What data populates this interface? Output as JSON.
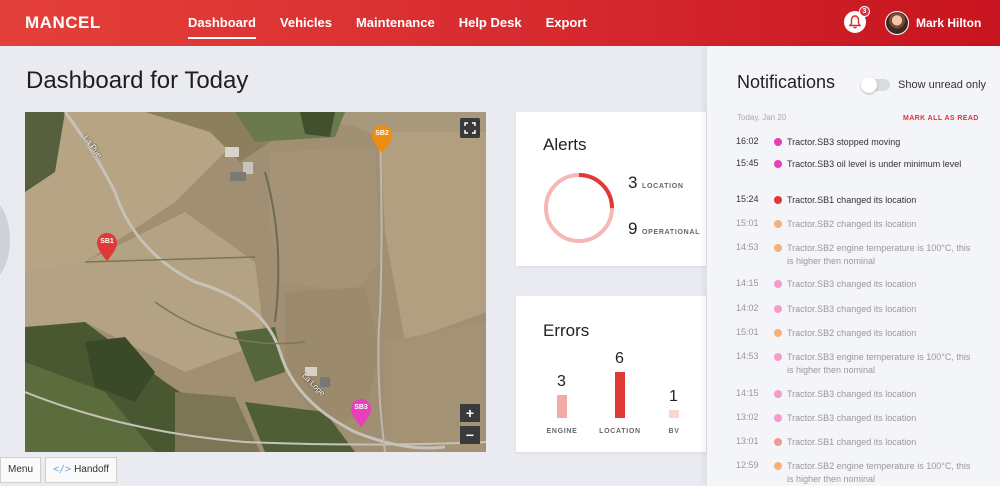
{
  "brand": "MANCEL",
  "nav": {
    "items": [
      {
        "label": "Dashboard",
        "active": true
      },
      {
        "label": "Vehicles",
        "active": false
      },
      {
        "label": "Maintenance",
        "active": false
      },
      {
        "label": "Help Desk",
        "active": false
      },
      {
        "label": "Export",
        "active": false
      }
    ]
  },
  "header": {
    "notification_count": "3",
    "user_name": "Mark Hilton",
    "accent_color": "#d62a2f"
  },
  "page": {
    "title": "Dashboard for Today"
  },
  "map": {
    "markers": [
      {
        "label": "SB2",
        "color": "#f08c10"
      },
      {
        "label": "SB1",
        "color": "#dd3a35"
      },
      {
        "label": "SB3",
        "color": "#e83fba"
      }
    ],
    "road_labels": [
      "La Pue",
      "La Loge"
    ],
    "zoom_in": "+",
    "zoom_out": "−",
    "fullscreen_icon": "fullscreen-icon"
  },
  "alerts": {
    "title": "Alerts",
    "location_count": "3",
    "location_label": "LOCATION",
    "operational_count": "9",
    "operational_label": "OPERATIONAL",
    "location_fraction": 0.25
  },
  "errors": {
    "title": "Errors",
    "bars": [
      {
        "label": "ENGINE",
        "value": "3",
        "color": "#f4aaa6"
      },
      {
        "label": "LOCATION",
        "value": "6",
        "color": "#e03a37"
      },
      {
        "label": "BV",
        "value": "1",
        "color": "#f9d5d3"
      }
    ]
  },
  "notifications": {
    "title": "Notifications",
    "toggle_label": "Show unread only",
    "date": "Today, Jan 20",
    "mark_all": "MARK ALL AS READ",
    "items": [
      {
        "time": "16:02",
        "text": "Tractor.SB3 stopped moving",
        "color": "#e83fba",
        "read": false
      },
      {
        "time": "15:45",
        "text": "Tractor.SB3 oil level is under minimum level",
        "color": "#e83fba",
        "read": false
      },
      {
        "time": "15:24",
        "text": "Tractor.SB1 changed its location",
        "color": "#dd3a35",
        "read": false
      },
      {
        "time": "15:01",
        "text": "Tractor.SB2 changed its location",
        "color": "#f4b07a",
        "read": true
      },
      {
        "time": "14:53",
        "text": "Tractor.SB2 engine temperature is 100°C, this is higher then nominal",
        "color": "#f4b07a",
        "read": true
      },
      {
        "time": "14:15",
        "text": "Tractor.SB3 changed its location",
        "color": "#f49ccc",
        "read": true
      },
      {
        "time": "14:02",
        "text": "Tractor.SB3 changed its location",
        "color": "#f49ccc",
        "read": true
      },
      {
        "time": "15:01",
        "text": "Tractor.SB2 changed its location",
        "color": "#f4b07a",
        "read": true
      },
      {
        "time": "14:53",
        "text": "Tractor.SB3 engine temperature is 100°C, this is higher then nominal",
        "color": "#f49ccc",
        "read": true
      },
      {
        "time": "14:15",
        "text": "Tractor.SB3 changed its location",
        "color": "#f49ccc",
        "read": true
      },
      {
        "time": "13:02",
        "text": "Tractor.SB3 changed its location",
        "color": "#f49ccc",
        "read": true
      },
      {
        "time": "13:01",
        "text": "Tractor.SB1 changed its location",
        "color": "#f29b95",
        "read": true
      },
      {
        "time": "12:59",
        "text": "Tractor.SB2 engine temperature is 100°C, this is higher then nominal",
        "color": "#f4b07a",
        "read": true
      }
    ]
  },
  "bottom": {
    "menu_label": "Menu",
    "handoff_label": "Handoff",
    "handoff_icon": "</>"
  }
}
